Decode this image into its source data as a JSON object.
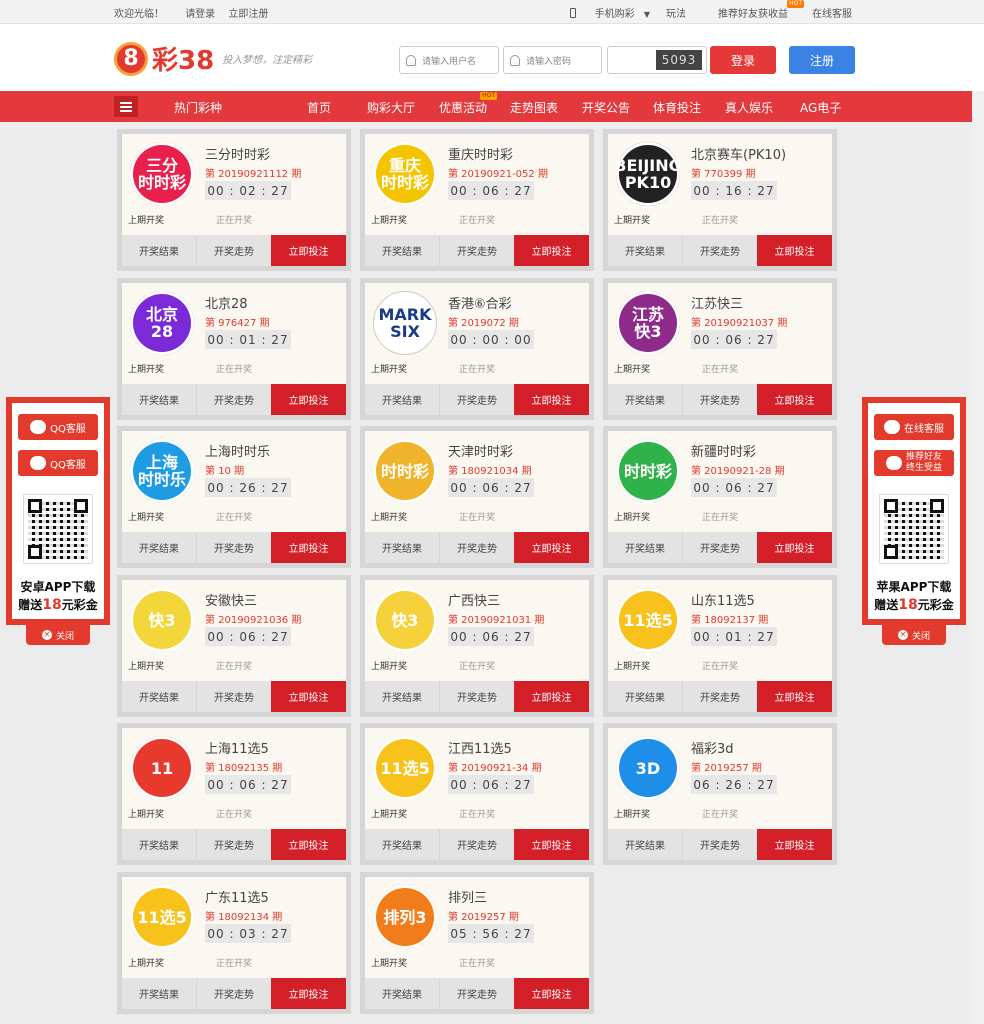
{
  "topbar": {
    "welcome": "欢迎光临！",
    "login": "请登录",
    "register": "立即注册",
    "mobile": "手机购彩",
    "play": "玩法",
    "refer": "推荐好友获收益",
    "hot": "HOT",
    "service": "在线客服"
  },
  "header": {
    "logo_num": "8",
    "logo_text": "彩38",
    "slogan": "投入梦想，注定精彩",
    "username_placeholder": "请输入用户名",
    "password_placeholder": "请输入密码",
    "captcha": "5093",
    "login_button": "登录",
    "register_button": "注册"
  },
  "nav": {
    "items": [
      "热门彩种",
      "首页",
      "购彩大厅",
      "优惠活动",
      "走势图表",
      "开奖公告",
      "体育投注",
      "真人娱乐",
      "AG电子"
    ],
    "hot": "HOT"
  },
  "card_labels": {
    "last": "上期开奖",
    "status": "正在开奖",
    "results": "开奖结果",
    "trend": "开奖走势",
    "bet": "立即投注"
  },
  "lotteries": [
    {
      "name": "三分时时彩",
      "issue": "第 20190921112 期",
      "timer": "00 : 02 : 27",
      "logo": "三分\n时时彩",
      "color": "#e8204e"
    },
    {
      "name": "重庆时时彩",
      "issue": "第 20190921-052 期",
      "timer": "00 : 06 : 27",
      "logo": "重庆\n时时彩",
      "color": "#f5c400"
    },
    {
      "name": "北京赛车(PK10)",
      "issue": "第 770399 期",
      "timer": "00 : 16 : 27",
      "logo": "BEIJING\nPK10",
      "color": "#222222"
    },
    {
      "name": "北京28",
      "issue": "第 976427 期",
      "timer": "00 : 01 : 27",
      "logo": "北京\n28",
      "color": "#7b2ad8"
    },
    {
      "name": "香港⑥合彩",
      "issue": "第 2019072 期",
      "timer": "00 : 00 : 00",
      "logo": "MARK\nSIX",
      "color": "#ffffff"
    },
    {
      "name": "江苏快三",
      "issue": "第 20190921037 期",
      "timer": "00 : 06 : 27",
      "logo": "江苏\n快3",
      "color": "#8e2a8a"
    },
    {
      "name": "上海时时乐",
      "issue": "第 10 期",
      "timer": "00 : 26 : 27",
      "logo": "上海\n时时乐",
      "color": "#1e9be3"
    },
    {
      "name": "天津时时彩",
      "issue": "第 180921034 期",
      "timer": "00 : 06 : 27",
      "logo": "时时彩",
      "color": "#f0b42c"
    },
    {
      "name": "新疆时时彩",
      "issue": "第 20190921-28 期",
      "timer": "00 : 06 : 27",
      "logo": "时时彩",
      "color": "#2fb24a"
    },
    {
      "name": "安徽快三",
      "issue": "第 20190921036 期",
      "timer": "00 : 06 : 27",
      "logo": "快3",
      "color": "#f3d63a"
    },
    {
      "name": "广西快三",
      "issue": "第 20190921031 期",
      "timer": "00 : 06 : 27",
      "logo": "快3",
      "color": "#f5d23c"
    },
    {
      "name": "山东11选5",
      "issue": "第 18092137 期",
      "timer": "00 : 01 : 27",
      "logo": "11选5",
      "color": "#f8c21c"
    },
    {
      "name": "上海11选5",
      "issue": "第 18092135 期",
      "timer": "00 : 06 : 27",
      "logo": "11",
      "color": "#e83a2c"
    },
    {
      "name": "江西11选5",
      "issue": "第 20190921-34 期",
      "timer": "00 : 06 : 27",
      "logo": "11选5",
      "color": "#f8c21c"
    },
    {
      "name": "福彩3d",
      "issue": "第 2019257 期",
      "timer": "06 : 26 : 27",
      "logo": "3D",
      "color": "#1f8ee8"
    },
    {
      "name": "广东11选5",
      "issue": "第 18092134 期",
      "timer": "00 : 03 : 27",
      "logo": "11选5",
      "color": "#f8c21c"
    },
    {
      "name": "排列三",
      "issue": "第 2019257 期",
      "timer": "05 : 56 : 27",
      "logo": "排列3",
      "color": "#f07c1a"
    }
  ],
  "side_left": {
    "qq1": "QQ客服",
    "qq2": "QQ客服",
    "line1": "安卓APP下载",
    "line2_a": "赠送",
    "line2_b": "18",
    "line2_c": "元彩金",
    "close": "关闭"
  },
  "side_right": {
    "service": "在线客服",
    "refer": "推荐好友\n终生受益",
    "line1": "苹果APP下载",
    "line2_a": "赠送",
    "line2_b": "18",
    "line2_c": "元彩金",
    "close": "关闭"
  }
}
